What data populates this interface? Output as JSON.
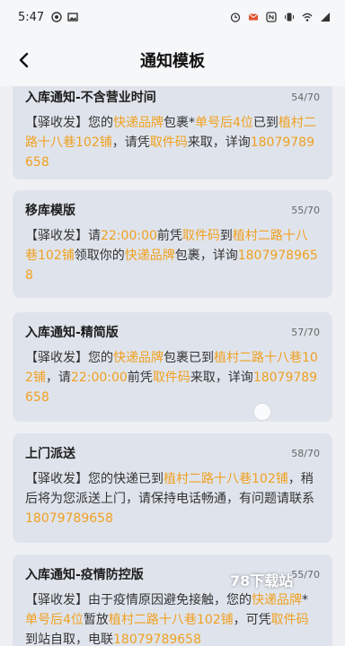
{
  "status": {
    "time": "5:47",
    "left_icons": [
      "location-icon",
      "image-icon"
    ],
    "right_icons": [
      "alarm-icon",
      "mail-icon",
      "nfc-icon",
      "vibrate-icon",
      "wifi-icon",
      "signal-icon"
    ]
  },
  "nav": {
    "back_icon": "chevron-left-icon",
    "title": "通知模板"
  },
  "templates": [
    {
      "title": "入库通知-不含营业时间",
      "count": "54/70",
      "segments": [
        {
          "text": "【驿收发】您的",
          "hl": false
        },
        {
          "text": "快递品牌",
          "hl": true
        },
        {
          "text": "包裹*",
          "hl": false
        },
        {
          "text": "单号后4位",
          "hl": true
        },
        {
          "text": "已到",
          "hl": false
        },
        {
          "text": "植村二路十八巷102铺",
          "hl": true
        },
        {
          "text": "，请凭",
          "hl": false
        },
        {
          "text": "取件码",
          "hl": true
        },
        {
          "text": "来取，详询",
          "hl": false
        },
        {
          "text": "18079789658",
          "hl": true
        }
      ]
    },
    {
      "title": "移库模版",
      "count": "55/70",
      "segments": [
        {
          "text": "【驿收发】请",
          "hl": false
        },
        {
          "text": "22:00:00",
          "hl": true
        },
        {
          "text": "前凭",
          "hl": false
        },
        {
          "text": "取件码",
          "hl": true
        },
        {
          "text": "到",
          "hl": false
        },
        {
          "text": "植村二路十八巷102铺",
          "hl": true
        },
        {
          "text": "领取你的",
          "hl": false
        },
        {
          "text": "快递品牌",
          "hl": true
        },
        {
          "text": "包裹，详询",
          "hl": false
        },
        {
          "text": "18079789658",
          "hl": true
        }
      ]
    },
    {
      "title": "入库通知-精简版",
      "count": "57/70",
      "segments": [
        {
          "text": "【驿收发】您的",
          "hl": false
        },
        {
          "text": "快递品牌",
          "hl": true
        },
        {
          "text": "包裹已到",
          "hl": false
        },
        {
          "text": "植村二路十八巷102铺",
          "hl": true
        },
        {
          "text": "，请",
          "hl": false
        },
        {
          "text": "22:00:00",
          "hl": true
        },
        {
          "text": "前凭",
          "hl": false
        },
        {
          "text": "取件码",
          "hl": true
        },
        {
          "text": "来取，详询",
          "hl": false
        },
        {
          "text": "18079789658",
          "hl": true
        }
      ]
    },
    {
      "title": "上门派送",
      "count": "58/70",
      "segments": [
        {
          "text": "【驿收发】您的快递已到",
          "hl": false
        },
        {
          "text": "植村二路十八巷102铺",
          "hl": true
        },
        {
          "text": "，稍后将为您派送上门，请保持电话畅通，有问题请联系",
          "hl": false
        },
        {
          "text": "18079789658",
          "hl": true
        }
      ]
    },
    {
      "title": "入库通知-疫情防控版",
      "count": "55/70",
      "segments": [
        {
          "text": "【驿收发】由于疫情原因避免接触，您的",
          "hl": false
        },
        {
          "text": "快递品牌",
          "hl": true
        },
        {
          "text": "*",
          "hl": false
        },
        {
          "text": "单号后4位",
          "hl": true
        },
        {
          "text": "暂放",
          "hl": false
        },
        {
          "text": "植村二路十八巷102铺",
          "hl": true
        },
        {
          "text": "，可凭",
          "hl": false
        },
        {
          "text": "取件码",
          "hl": true
        },
        {
          "text": "到站自取，电联",
          "hl": false
        },
        {
          "text": "18079789658",
          "hl": true
        }
      ]
    }
  ],
  "watermark": "78下载站",
  "colors": {
    "highlight": "#f0a020",
    "card_bg": "#dfe4ec",
    "page_bg": "#eef0f4"
  }
}
